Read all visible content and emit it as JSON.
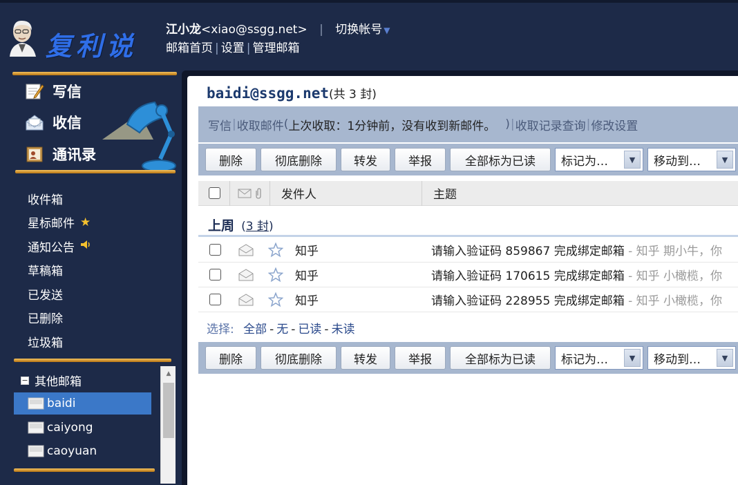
{
  "header": {
    "logo_text": "复利说",
    "user_name": "江小龙",
    "user_email": "<xiao@ssgg.net>",
    "switch_account": "切换帐号",
    "nav": [
      "邮箱首页",
      "设置",
      "管理邮箱"
    ]
  },
  "sidebar": {
    "compose": "写信",
    "inbox_check": "收信",
    "contacts": "通讯录",
    "folders": [
      {
        "label": "收件箱",
        "icon": ""
      },
      {
        "label": "星标邮件",
        "icon": "★"
      },
      {
        "label": "通知公告",
        "icon": "🔈"
      },
      {
        "label": "草稿箱",
        "icon": ""
      },
      {
        "label": "已发送",
        "icon": ""
      },
      {
        "label": "已删除",
        "icon": ""
      },
      {
        "label": "垃圾箱",
        "icon": ""
      }
    ],
    "other_title": "其他邮箱",
    "accounts": [
      "baidi",
      "caiyong",
      "caoyuan"
    ],
    "active_account": "baidi"
  },
  "main": {
    "address": "baidi@ssgg.net",
    "count_text": "(共 3 封)",
    "info": {
      "compose": "写信",
      "receive": "收取邮件",
      "open_paren": "(",
      "status": " 上次收取：1分钟前，没有收到新邮件。",
      "close_paren": ")",
      "history": "收取记录查询",
      "settings": "修改设置"
    },
    "toolbar": {
      "delete": "删除",
      "purge": "彻底删除",
      "forward": "转发",
      "report": "举报",
      "mark_all_read": "全部标为已读",
      "mark_as": "标记为…",
      "move_to": "移动到…"
    },
    "columns": {
      "from": "发件人",
      "subject": "主题"
    },
    "group": {
      "label": "上周",
      "count_open": "(",
      "count": "3 封",
      "count_close": ")"
    },
    "emails": [
      {
        "from": "知乎",
        "subject": "请输入验证码 859867 完成绑定邮箱",
        "preview": " - 知乎 期小牛，你"
      },
      {
        "from": "知乎",
        "subject": "请输入验证码 170615 完成绑定邮箱",
        "preview": " - 知乎 小橄榄，你"
      },
      {
        "from": "知乎",
        "subject": "请输入验证码 228955 完成绑定邮箱",
        "preview": " - 知乎 小橄榄，你"
      }
    ],
    "select": {
      "label": "选择:",
      "all": "全部",
      "none": "无",
      "read": "已读",
      "unread": "未读"
    }
  },
  "colors": {
    "background": "#1d2a48",
    "accent_gold": "#e3a02c",
    "toolbar": "#a7b7cf",
    "active_account": "#3b78c8",
    "logo_blue": "#2f6ee8"
  }
}
